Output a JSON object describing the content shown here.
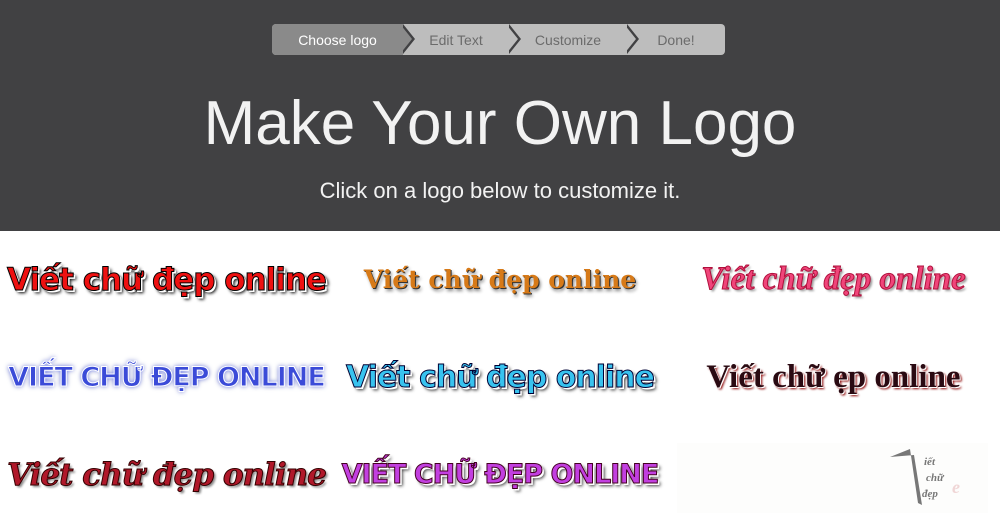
{
  "steps": [
    {
      "label": "Choose logo",
      "active": true
    },
    {
      "label": "Edit Text"
    },
    {
      "label": "Customize"
    },
    {
      "label": "Done!"
    }
  ],
  "header": {
    "title": "Make Your Own Logo",
    "subtitle": "Click on a logo below to customize it."
  },
  "logos": [
    "Viết chữ đẹp online",
    "Viết chữ đẹp online",
    "Viết chữ đẹp online",
    "Viết chữ đẹp online",
    "Viết chữ đẹp online",
    "Viết chữ  ẹp online",
    "Viết chữ đẹp online",
    "Viết chữ đẹp online"
  ],
  "watermark": "Viết chữ đẹp online"
}
